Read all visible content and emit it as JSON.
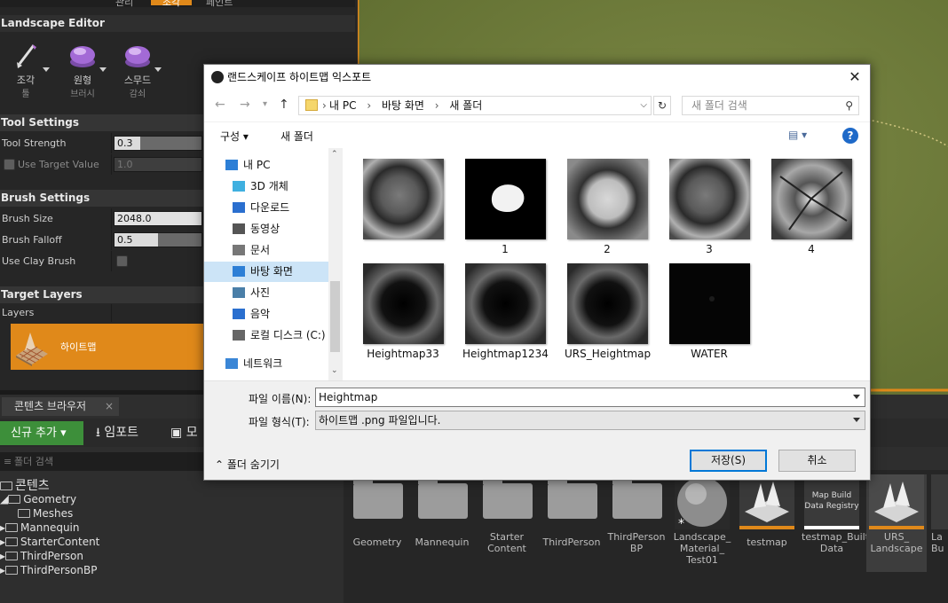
{
  "left_panel": {
    "top_tabs": [
      "관리",
      "조각",
      "페인트"
    ],
    "landscape_editor_title": "Landscape Editor",
    "tools": [
      {
        "label": "조각",
        "sub": "툴",
        "icon": "sculpt-brush-icon"
      },
      {
        "label": "원형",
        "sub": "브러시",
        "icon": "circle-brush-icon"
      },
      {
        "label": "스무드",
        "sub": "감쇠",
        "icon": "smooth-falloff-icon"
      }
    ],
    "tool_settings_title": "Tool Settings",
    "tool_strength_label": "Tool Strength",
    "tool_strength_value": "0.3",
    "tool_strength_fraction": 0.3,
    "use_target_value_label": "Use Target Value",
    "use_target_value_value": "1.0",
    "brush_settings_title": "Brush Settings",
    "brush_size_label": "Brush Size",
    "brush_size_value": "2048.0",
    "brush_falloff_label": "Brush Falloff",
    "brush_falloff_value": "0.5",
    "brush_falloff_fraction": 0.5,
    "use_clay_brush_label": "Use Clay Brush",
    "target_layers_title": "Target Layers",
    "layers_label": "Layers",
    "heightmap_layer_label": "하이트맵"
  },
  "content_browser": {
    "tab_label": "콘텐츠 브라우저",
    "add_new_label": "신규 추가",
    "import_label": "임포트",
    "save_all_label": "모",
    "search_placeholder": "폴더 검색",
    "tree": [
      {
        "label": "콘텐츠",
        "level": 0
      },
      {
        "label": "Geometry",
        "level": 1
      },
      {
        "label": "Meshes",
        "level": 2
      },
      {
        "label": "Mannequin",
        "level": 1
      },
      {
        "label": "StarterContent",
        "level": 1
      },
      {
        "label": "ThirdPerson",
        "level": 1
      },
      {
        "label": "ThirdPersonBP",
        "level": 1
      }
    ],
    "assets": [
      {
        "name": "Geometry",
        "kind": "folder"
      },
      {
        "name": "Mannequin",
        "kind": "folder"
      },
      {
        "name": "Starter Content",
        "kind": "folder"
      },
      {
        "name": "ThirdPerson",
        "kind": "folder"
      },
      {
        "name": "ThirdPerson BP",
        "kind": "folder"
      },
      {
        "name": "Landscape_ Material_ Test01",
        "kind": "material"
      },
      {
        "name": "testmap",
        "kind": "map"
      },
      {
        "name": "testmap_Built Data",
        "kind": "registry",
        "thumb_text": "Map Build Data Registry"
      },
      {
        "name": "URS_ Landscape",
        "kind": "map"
      },
      {
        "name": "La Bu",
        "kind": "map"
      }
    ]
  },
  "dialog": {
    "title": "랜드스케이프 하이트맵 익스포트",
    "close_glyph": "✕",
    "breadcrumb": [
      "내 PC",
      "바탕 화면",
      "새 폴더"
    ],
    "search_placeholder": "새 폴더 검색",
    "organize_label": "구성",
    "new_folder_label": "새 폴더",
    "nav_items": [
      {
        "label": "내 PC",
        "icon": "pc-icon"
      },
      {
        "label": "3D 개체",
        "icon": "3d-objects-icon"
      },
      {
        "label": "다운로드",
        "icon": "download-icon"
      },
      {
        "label": "동영상",
        "icon": "video-icon"
      },
      {
        "label": "문서",
        "icon": "document-icon"
      },
      {
        "label": "바탕 화면",
        "icon": "desktop-icon",
        "selected": true
      },
      {
        "label": "사진",
        "icon": "pictures-icon"
      },
      {
        "label": "음악",
        "icon": "music-icon"
      },
      {
        "label": "로컬 디스크 (C:)",
        "icon": "drive-icon"
      },
      {
        "label": "네트워크",
        "icon": "network-icon"
      }
    ],
    "files": [
      {
        "caption": "",
        "style": "crater-gray"
      },
      {
        "caption": "1",
        "style": "white-blob"
      },
      {
        "caption": "2",
        "style": "crater-light"
      },
      {
        "caption": "3",
        "style": "crater-gray"
      },
      {
        "caption": "4",
        "style": "crater-veins"
      },
      {
        "caption": "Heightmap33",
        "style": "dark-hole"
      },
      {
        "caption": "Heightmap1234",
        "style": "dark-hole"
      },
      {
        "caption": "URS_Heightmap",
        "style": "dark-hole"
      },
      {
        "caption": "WATER",
        "style": "black"
      }
    ],
    "file_name_label": "파일 이름(N):",
    "file_name_value": "Heightmap",
    "file_type_label": "파일 형식(T):",
    "file_type_value": "하이트맵 .png 파일입니다.",
    "hide_folders_label": "폴더 숨기기",
    "save_label": "저장(S)",
    "cancel_label": "취소"
  }
}
